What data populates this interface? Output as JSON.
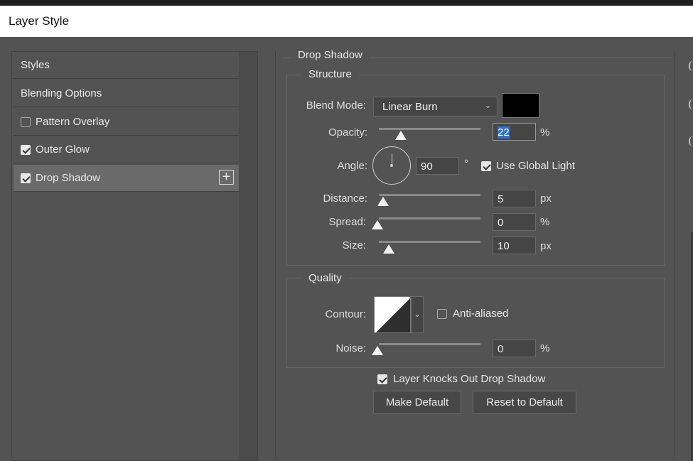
{
  "window": {
    "title": "Layer Style"
  },
  "sidebar": {
    "items": [
      {
        "label": "Styles",
        "checkbox": null
      },
      {
        "label": "Blending Options",
        "checkbox": null
      },
      {
        "label": "Pattern Overlay",
        "checkbox": false
      },
      {
        "label": "Outer Glow",
        "checkbox": true
      },
      {
        "label": "Drop Shadow",
        "checkbox": true,
        "selected": true
      }
    ],
    "add_icon": "plus-square-icon"
  },
  "drop_shadow": {
    "section_title": "Drop Shadow",
    "structure": {
      "title": "Structure",
      "blend_mode_label": "Blend Mode:",
      "blend_mode_value": "Linear Burn",
      "shadow_color": "#000000",
      "opacity_label": "Opacity:",
      "opacity_value": "22",
      "opacity_unit": "%",
      "angle_label": "Angle:",
      "angle_value": "90",
      "angle_unit": "°",
      "use_global_light_label": "Use Global Light",
      "use_global_light": true,
      "distance_label": "Distance:",
      "distance_value": "5",
      "distance_unit": "px",
      "spread_label": "Spread:",
      "spread_value": "0",
      "spread_unit": "%",
      "size_label": "Size:",
      "size_value": "10",
      "size_unit": "px"
    },
    "quality": {
      "title": "Quality",
      "contour_label": "Contour:",
      "anti_aliased_label": "Anti-aliased",
      "anti_aliased": false,
      "noise_label": "Noise:",
      "noise_value": "0",
      "noise_unit": "%"
    },
    "layer_knocks_out_label": "Layer Knocks Out Drop Shadow",
    "layer_knocks_out": true,
    "make_default_label": "Make Default",
    "reset_default_label": "Reset to Default"
  }
}
